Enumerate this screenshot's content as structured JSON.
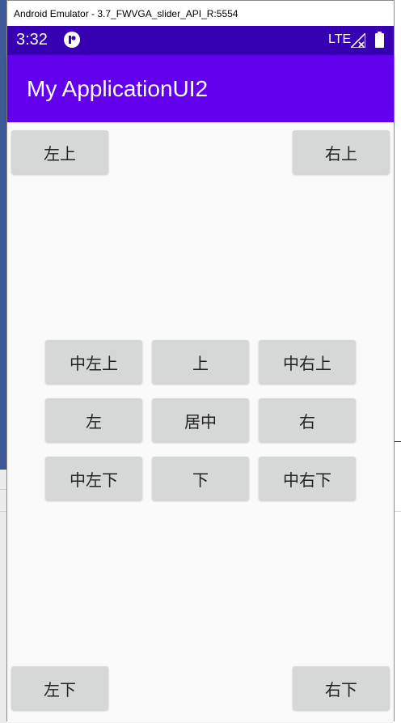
{
  "window": {
    "title": "Android Emulator - 3.7_FWVGA_slider_API_R:5554"
  },
  "status_bar": {
    "time": "3:32",
    "network": "LTE",
    "icons": [
      "app-notification-icon",
      "signal-icon",
      "battery-icon"
    ]
  },
  "app_bar": {
    "title": "My ApplicationUI2",
    "color": "#6200ee",
    "status_color": "#3700b3"
  },
  "buttons": {
    "top_left": "左上",
    "top_right": "右上",
    "center_left_top": "中左上",
    "center_top": "上",
    "center_right_top": "中右上",
    "left": "左",
    "center": "居中",
    "right": "右",
    "center_left_bottom": "中左下",
    "center_bottom": "下",
    "center_right_bottom": "中右下",
    "bottom_left": "左下",
    "bottom_right": "右下"
  }
}
